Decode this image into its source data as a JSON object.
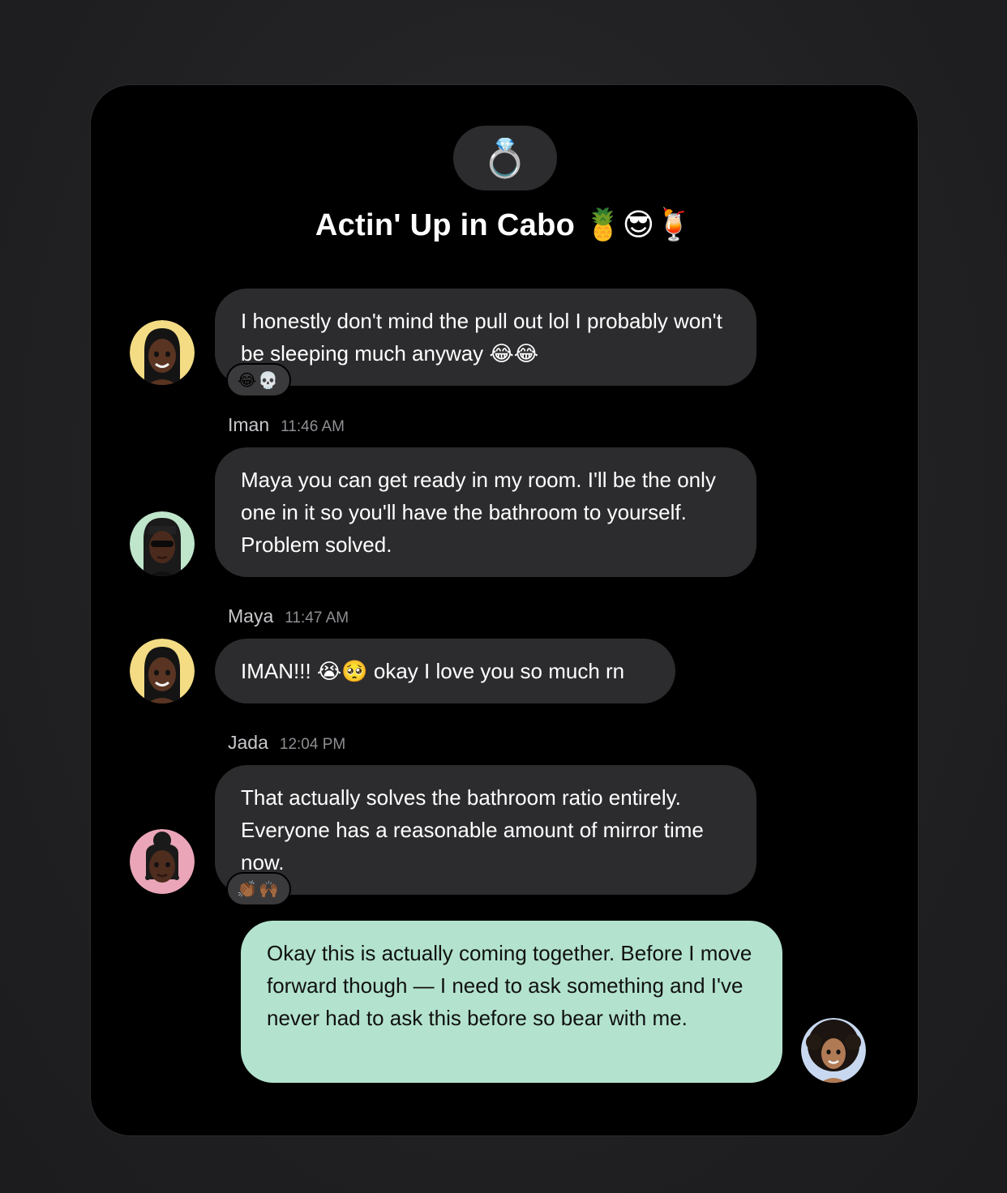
{
  "chat": {
    "group_icon": "💍",
    "title": "Actin' Up in Cabo 🍍😎🍹"
  },
  "messages": [
    {
      "text": "I honestly don't mind the pull out lol I probably won't be sleeping much anyway 😂😂",
      "reactions": "😂💀",
      "avatar": "maya-avatar"
    },
    {
      "sender": "Iman",
      "time": "11:46 AM",
      "text": "Maya you can get ready in my room. I'll be the only one in it so you'll have the bathroom to yourself. Problem solved.",
      "avatar": "iman-avatar"
    },
    {
      "sender": "Maya",
      "time": "11:47 AM",
      "text": "IMAN!!! 😭🥺 okay I love you so much rn",
      "avatar": "maya-avatar"
    },
    {
      "sender": "Jada",
      "time": "12:04 PM",
      "text": "That actually solves the bathroom ratio entirely. Everyone has a reasonable amount of mirror time now.",
      "reactions": "👏🏾🙌🏾",
      "avatar": "jada-avatar"
    },
    {
      "text": "Okay this is actually coming together. Before I move forward though — I need to ask something and I've never had to ask this before so bear with me.",
      "outgoing": true,
      "avatar": "self-avatar"
    }
  ],
  "colors": {
    "background": "#1f1f21",
    "card": "#000000",
    "incoming_bubble": "#2c2c2e",
    "outgoing_bubble": "#b3e3cf",
    "maya_avatar_bg": "#f3dc84",
    "iman_avatar_bg": "#bfe6cb",
    "jada_avatar_bg": "#eaa6b8",
    "self_avatar_bg": "#c8d8f0"
  }
}
